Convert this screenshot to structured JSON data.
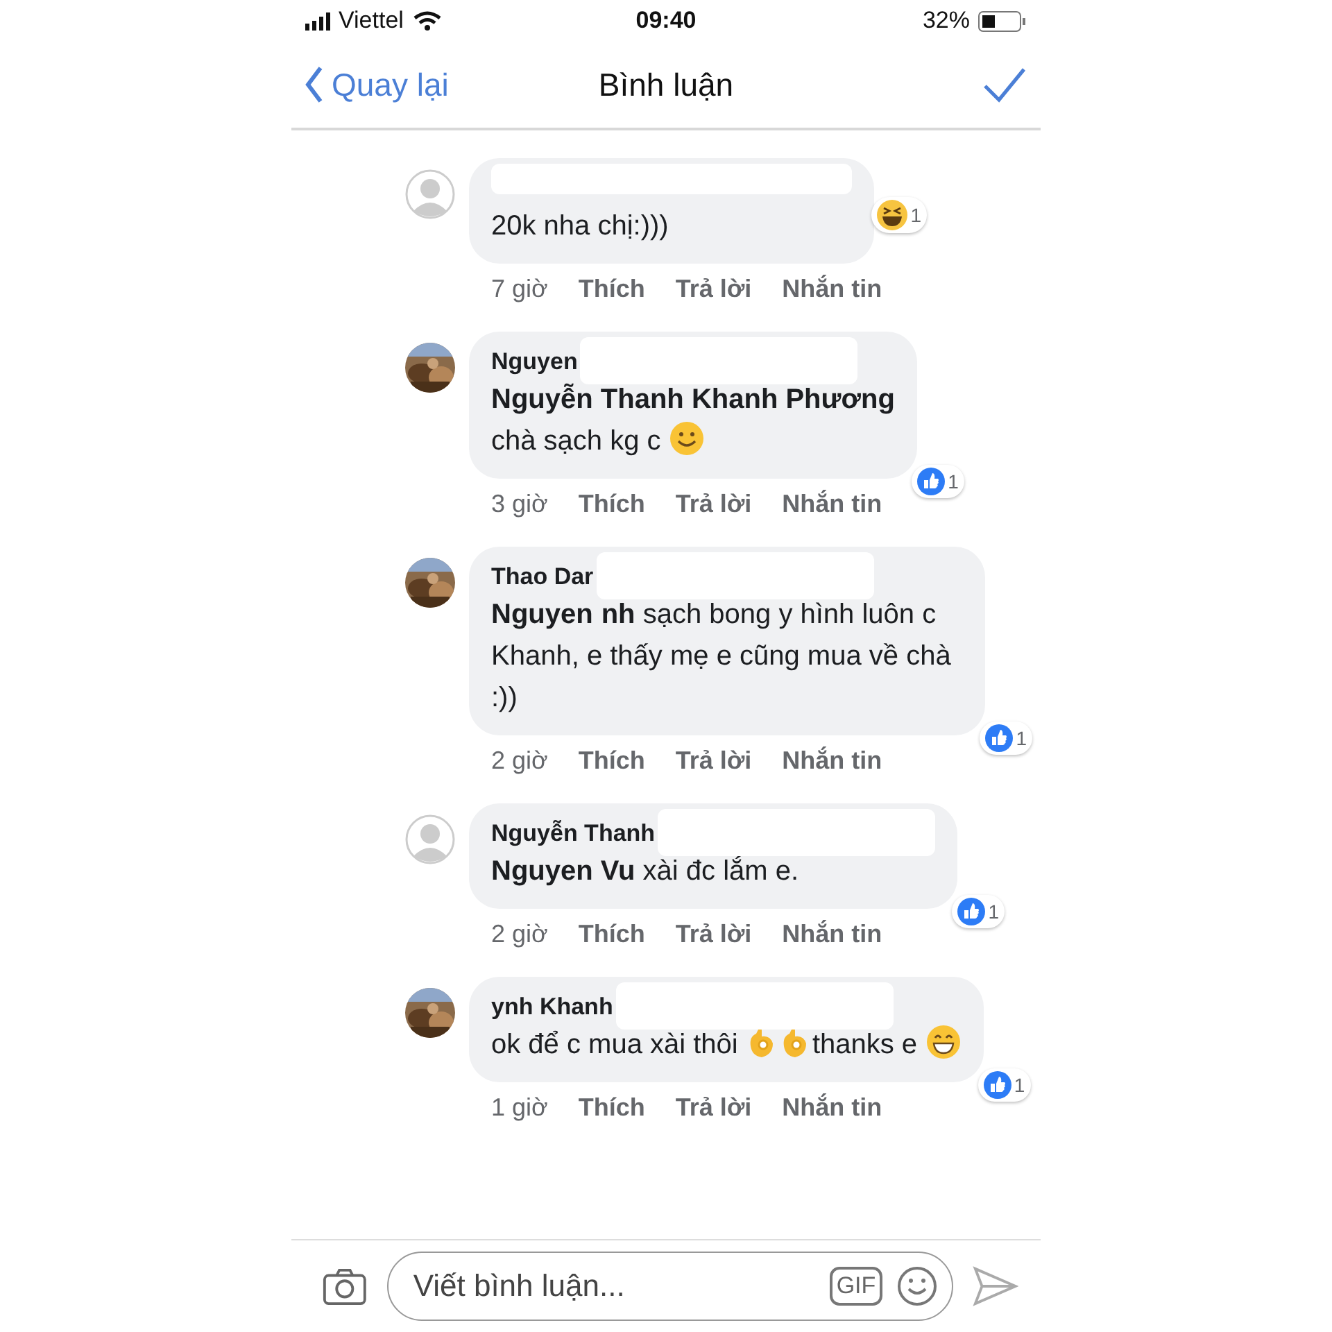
{
  "status_bar": {
    "carrier": "Viettel",
    "time": "09:40",
    "battery": "32%"
  },
  "nav": {
    "back": "Quay lại",
    "title": "Bình luận"
  },
  "comments": [
    {
      "avatar": {
        "kind": "default"
      },
      "redacted": true,
      "body": [
        {
          "kind": "text",
          "text": "20k nha chị:)))"
        }
      ],
      "time": "7 giờ",
      "actions": [
        "Thích",
        "Trả lời",
        "Nhắn tin"
      ],
      "reaction": {
        "kind": "haha",
        "count": "1"
      }
    },
    {
      "avatar": {
        "kind": "picture"
      },
      "author": "Nguyen",
      "redacted": true,
      "body": [
        {
          "kind": "mention",
          "text": "Nguyễn Thanh Khanh Phương"
        },
        {
          "kind": "break"
        },
        {
          "kind": "text",
          "text": "chà  sạch kg c "
        },
        {
          "kind": "smile-emoji"
        }
      ],
      "time": "3 giờ",
      "actions": [
        "Thích",
        "Trả lời",
        "Nhắn tin"
      ],
      "reaction": {
        "kind": "like",
        "count": "1"
      }
    },
    {
      "avatar": {
        "kind": "picture"
      },
      "author": "Thao Dar",
      "redacted": true,
      "body": [
        {
          "kind": "mention",
          "text": "Nguyen"
        },
        {
          "kind": "mention",
          "text": "nh"
        },
        {
          "kind": "text",
          "text": " sạch bong y hình luôn c Khanh, e thấy mẹ e cũng mua về chà :))"
        }
      ],
      "time": "2 giờ",
      "actions": [
        "Thích",
        "Trả lời",
        "Nhắn tin"
      ],
      "reaction": {
        "kind": "like",
        "count": "1"
      }
    },
    {
      "avatar": {
        "kind": "default"
      },
      "author": "Nguyễn Thanh",
      "redacted": true,
      "body": [
        {
          "kind": "mention",
          "text": "Nguyen Vu"
        },
        {
          "kind": "text",
          "text": " xài đc lắm e."
        }
      ],
      "time": "2 giờ",
      "actions": [
        "Thích",
        "Trả lời",
        "Nhắn tin"
      ],
      "reaction": {
        "kind": "like",
        "count": "1"
      }
    },
    {
      "avatar": {
        "kind": "picture"
      },
      "author": "ynh Khanh",
      "redacted": true,
      "body": [
        {
          "kind": "text",
          "text": "ok để c mua xài thôi "
        },
        {
          "kind": "ok-emoji"
        },
        {
          "kind": "ok-emoji"
        },
        {
          "kind": "text",
          "text": "thanks e "
        },
        {
          "kind": "grin-emoji"
        }
      ],
      "time": "1 giờ",
      "actions": [
        "Thích",
        "Trả lời",
        "Nhắn tin"
      ],
      "reaction": {
        "kind": "like",
        "count": "1"
      }
    }
  ],
  "composer": {
    "placeholder": "Viết bình luận...",
    "gif": "GIF"
  }
}
